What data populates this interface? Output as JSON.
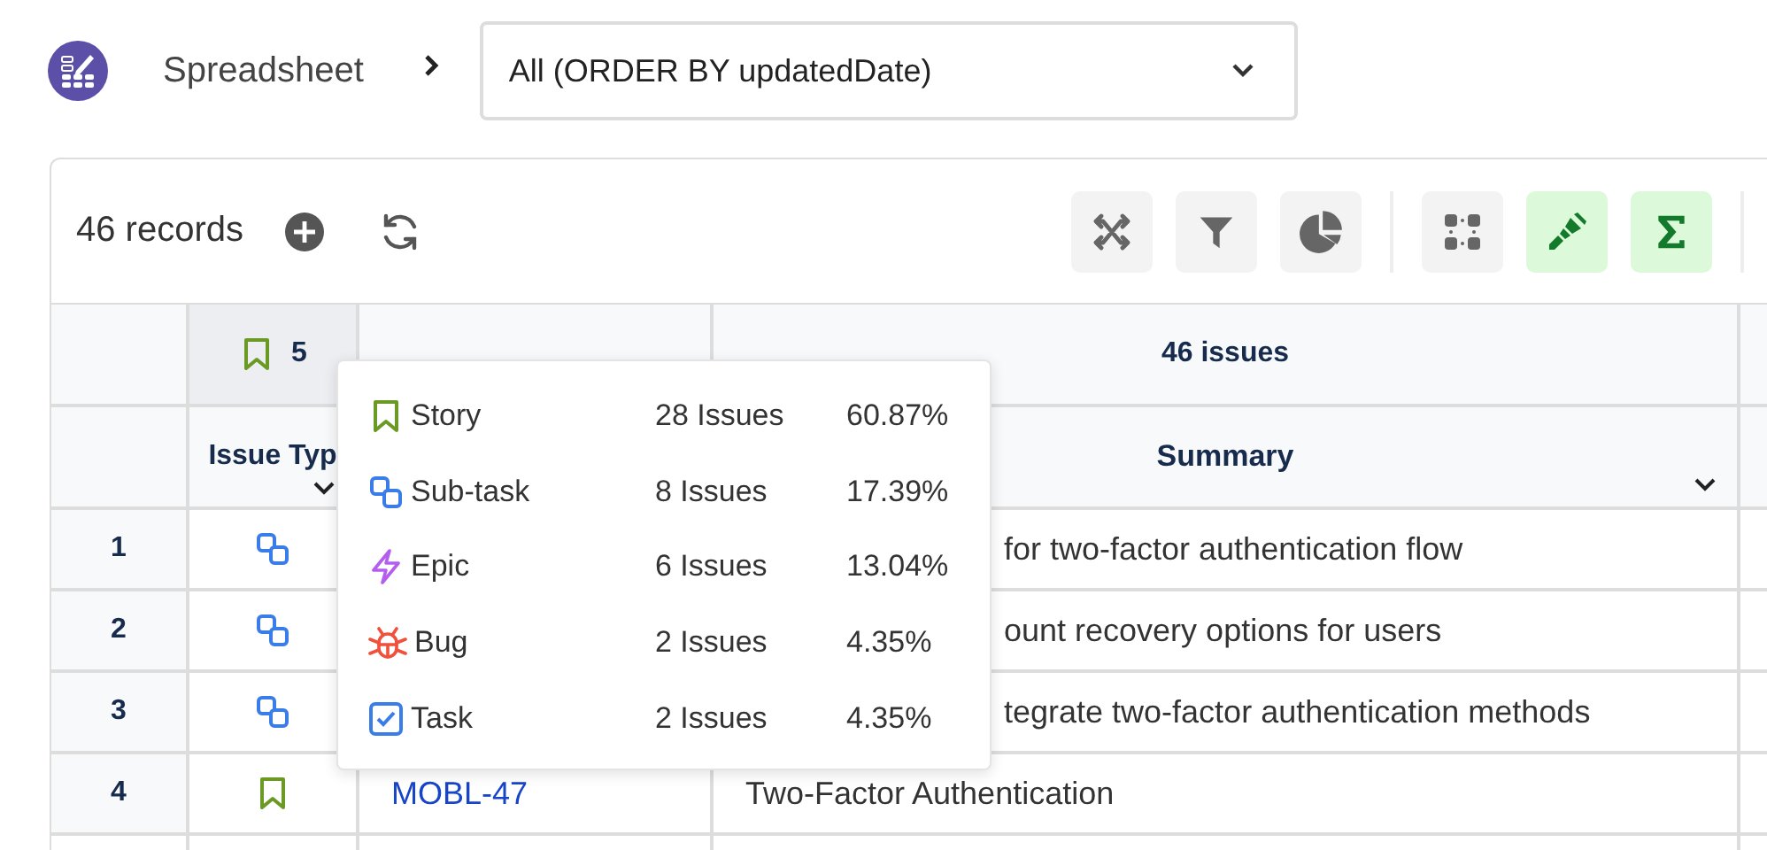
{
  "breadcrumb": {
    "app": "Spreadsheet",
    "view": {
      "value": "All (ORDER BY updatedDate)"
    }
  },
  "toolbar": {
    "records": "46 records",
    "tools": [
      {
        "kind": "shuffle",
        "active": false
      },
      {
        "kind": "filter",
        "active": false
      },
      {
        "kind": "pie",
        "active": false
      },
      {
        "kind": "grid",
        "active": false
      },
      {
        "kind": "brush",
        "active": true
      },
      {
        "kind": "sigma",
        "active": true
      }
    ]
  },
  "table": {
    "group_row": {
      "type_count": "5",
      "summary_count": "46 issues"
    },
    "columns": [
      {
        "label": "Issue Typ"
      },
      {
        "label": "Summary"
      }
    ],
    "rows": [
      {
        "number": "1",
        "kind": "subtask",
        "summary": "for two-factor authentication flow",
        "partial": true
      },
      {
        "number": "2",
        "kind": "subtask",
        "summary": "ount recovery options for users",
        "partial": true
      },
      {
        "number": "3",
        "kind": "subtask",
        "summary": "tegrate two-factor authentication methods",
        "partial": true
      },
      {
        "number": "4",
        "kind": "story",
        "key": "MOBL-47",
        "summary": "Two-Factor Authentication",
        "partial": false
      }
    ]
  },
  "popup": {
    "items": [
      {
        "kind": "story",
        "label": "Story",
        "count": "28 Issues",
        "percent": "60.87%"
      },
      {
        "kind": "subtask",
        "label": "Sub-task",
        "count": "8 Issues",
        "percent": "17.39%"
      },
      {
        "kind": "epic",
        "label": "Epic",
        "count": "6 Issues",
        "percent": "13.04%"
      },
      {
        "kind": "bug",
        "label": "Bug",
        "count": "2 Issues",
        "percent": "4.35%"
      },
      {
        "kind": "task",
        "label": "Task",
        "count": "2 Issues",
        "percent": "4.35%"
      }
    ]
  }
}
